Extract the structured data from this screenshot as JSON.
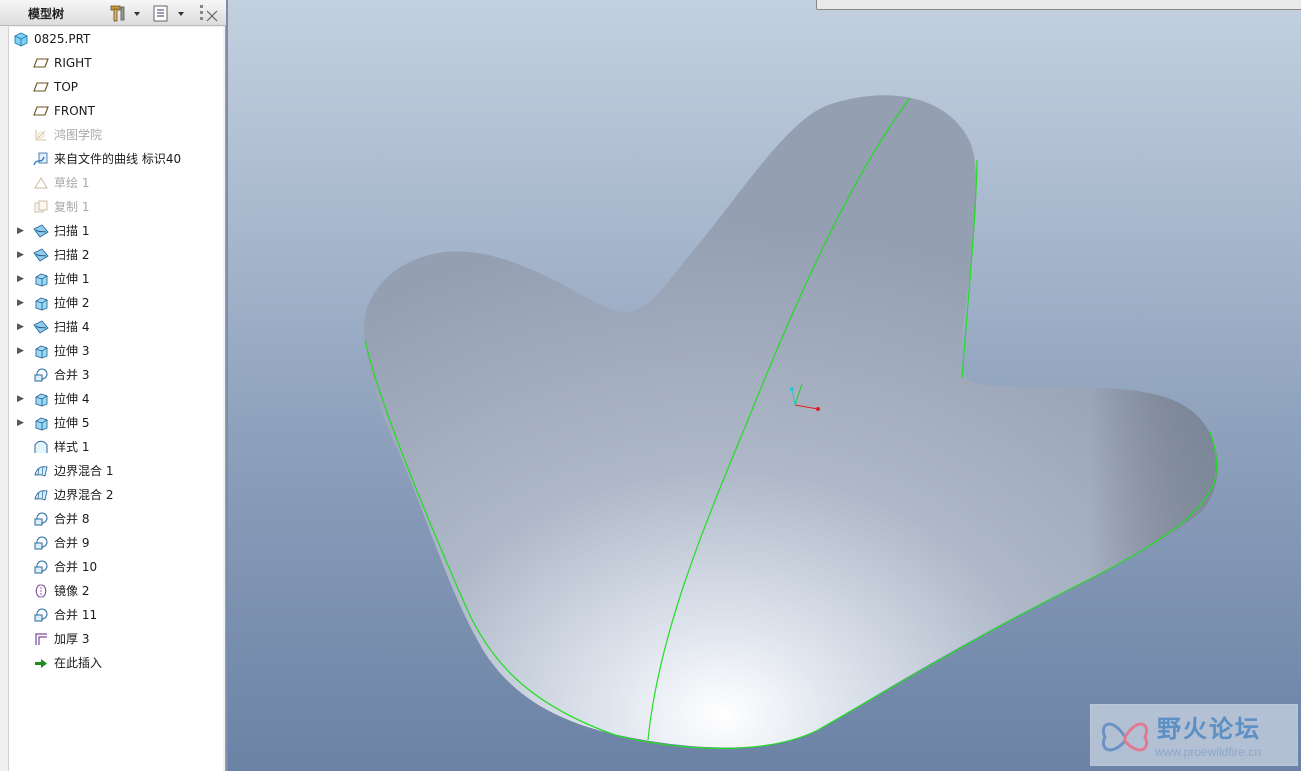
{
  "panel": {
    "title": "模型树"
  },
  "tree": {
    "root": {
      "label": "0825.PRT",
      "icon": "part-icon"
    },
    "items": [
      {
        "label": "RIGHT",
        "icon": "datum-plane-icon",
        "expandable": false,
        "dimmed": false
      },
      {
        "label": "TOP",
        "icon": "datum-plane-icon",
        "expandable": false,
        "dimmed": false
      },
      {
        "label": "FRONT",
        "icon": "datum-plane-icon",
        "expandable": false,
        "dimmed": false
      },
      {
        "label": "鸿图学院",
        "icon": "coordinate-system-icon",
        "expandable": false,
        "dimmed": true
      },
      {
        "label": "来自文件的曲线 标识40",
        "icon": "curve-from-file-icon",
        "expandable": false,
        "dimmed": false
      },
      {
        "label": "草绘 1",
        "icon": "sketch-icon",
        "expandable": false,
        "dimmed": true
      },
      {
        "label": "复制 1",
        "icon": "copy-icon",
        "expandable": false,
        "dimmed": true
      },
      {
        "label": "扫描 1",
        "icon": "sweep-icon",
        "expandable": true,
        "dimmed": false
      },
      {
        "label": "扫描 2",
        "icon": "sweep-icon",
        "expandable": true,
        "dimmed": false
      },
      {
        "label": "拉伸 1",
        "icon": "extrude-icon",
        "expandable": true,
        "dimmed": false
      },
      {
        "label": "拉伸 2",
        "icon": "extrude-icon",
        "expandable": true,
        "dimmed": false
      },
      {
        "label": "扫描 4",
        "icon": "sweep-icon",
        "expandable": true,
        "dimmed": false
      },
      {
        "label": "拉伸 3",
        "icon": "extrude-icon",
        "expandable": true,
        "dimmed": false
      },
      {
        "label": "合并 3",
        "icon": "merge-icon",
        "expandable": false,
        "dimmed": false
      },
      {
        "label": "拉伸 4",
        "icon": "extrude-icon",
        "expandable": true,
        "dimmed": false
      },
      {
        "label": "拉伸 5",
        "icon": "extrude-icon",
        "expandable": true,
        "dimmed": false
      },
      {
        "label": "样式 1",
        "icon": "style-icon",
        "expandable": false,
        "dimmed": false
      },
      {
        "label": "边界混合 1",
        "icon": "boundary-blend-icon",
        "expandable": false,
        "dimmed": false
      },
      {
        "label": "边界混合 2",
        "icon": "boundary-blend-icon",
        "expandable": false,
        "dimmed": false
      },
      {
        "label": "合并 8",
        "icon": "merge-icon",
        "expandable": false,
        "dimmed": false
      },
      {
        "label": "合并 9",
        "icon": "merge-icon",
        "expandable": false,
        "dimmed": false
      },
      {
        "label": "合并 10",
        "icon": "merge-icon",
        "expandable": false,
        "dimmed": false
      },
      {
        "label": "镜像 2",
        "icon": "mirror-icon",
        "expandable": false,
        "dimmed": false
      },
      {
        "label": "合并 11",
        "icon": "merge-icon",
        "expandable": false,
        "dimmed": false
      },
      {
        "label": "加厚 3",
        "icon": "thicken-icon",
        "expandable": false,
        "dimmed": false
      },
      {
        "label": "在此插入",
        "icon": "insert-here-arrow-icon",
        "expandable": false,
        "dimmed": false
      }
    ]
  },
  "watermark": {
    "title": "野火论坛",
    "url": "www.proewildfire.cn"
  },
  "colors": {
    "edge_highlight": "#22dd22",
    "surface": "#a7b1c2",
    "csys_x": "#e02020",
    "csys_y": "#22cc22",
    "csys_z": "#20c8d8"
  }
}
